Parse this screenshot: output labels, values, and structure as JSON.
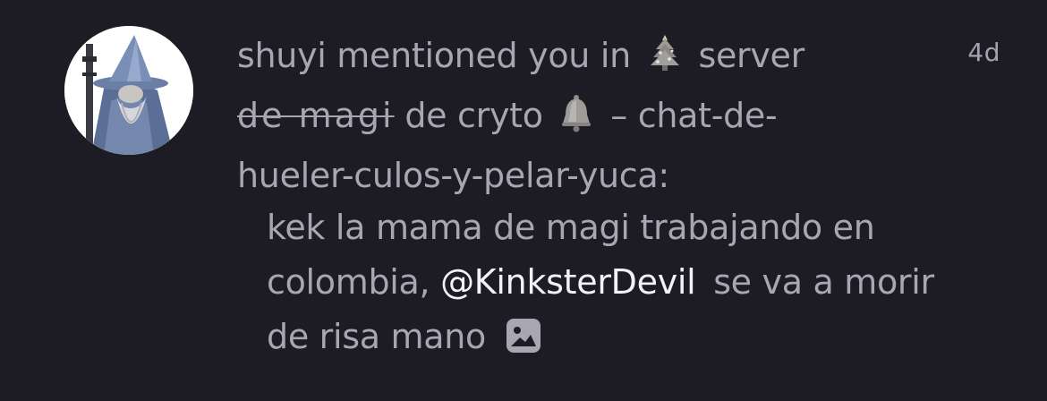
{
  "notification": {
    "timestamp": "4d",
    "header": {
      "prefix": "shuyi mentioned you in",
      "server_word": "server",
      "server_name_strike": "de magi",
      "server_name_rest": "de cryto",
      "separator": "–",
      "channel_part1": "chat-de-",
      "channel_part2": "hueler-culos-y-pelar-yuca:"
    },
    "message": {
      "line1": "kek la mama de magi trabajando en",
      "line2_pre": "colombia,",
      "mention": "@KinksterDevil",
      "line2_post": "se va a morir",
      "line3": "de risa mano"
    },
    "icons": {
      "avatar": "wizard-avatar",
      "tree": "christmas-tree-icon",
      "bell": "bell-icon",
      "attachment": "image-attachment-icon"
    },
    "colors": {
      "background": "#1d1c25",
      "text_muted": "#a7a7b1",
      "mention": "#f2f2f5"
    }
  }
}
